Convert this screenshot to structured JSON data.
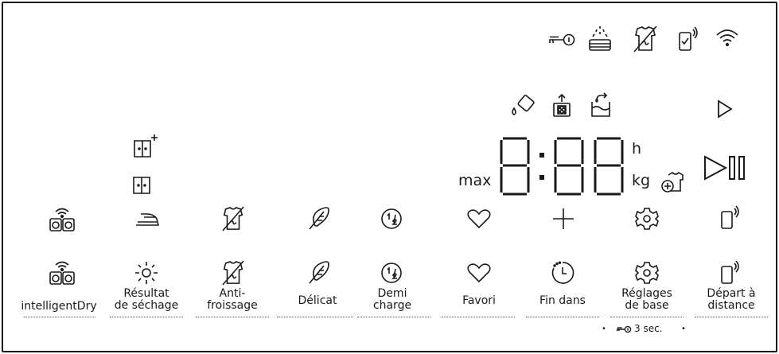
{
  "status_icons": [
    "key-lock-icon",
    "rinse-hold-icon",
    "no-crease-icon",
    "remote-ready-icon",
    "wifi-icon"
  ],
  "cycle_icons": [
    "drop-detergent-icon",
    "drum-clean-icon",
    "water-tank-icon",
    "play-icon"
  ],
  "program_icons": [
    "dry-level-plus-icon",
    "dry-level-icon"
  ],
  "display": {
    "time": "8:88",
    "unit_hours": "h",
    "unit_kg": "kg",
    "max_label": "max"
  },
  "buttons": [
    {
      "id": "intelligentdry",
      "label": "intelligentDry"
    },
    {
      "id": "drying-result",
      "label": "Résultat de séchage"
    },
    {
      "id": "anti-crease",
      "label": "Anti- froissage"
    },
    {
      "id": "delicate",
      "label": "Délicat"
    },
    {
      "id": "half-load",
      "label": "Demi charge"
    },
    {
      "id": "favorite",
      "label": "Favori"
    },
    {
      "id": "end-in",
      "label": "Fin dans"
    },
    {
      "id": "basic-settings",
      "label": "Réglages de base"
    },
    {
      "id": "remote-start",
      "label": "Départ à distance"
    }
  ],
  "labels": {
    "intelligentdry_l1": "intelligentDry",
    "drying_result_l1": "Résultat",
    "drying_result_l2": "de séchage",
    "anti_crease_l1": "Anti-",
    "anti_crease_l2": "froissage",
    "delicate_l1": "Délicat",
    "half_load_l1": "Demi",
    "half_load_l2": "charge",
    "favorite_l1": "Favori",
    "end_in_l1": "Fin dans",
    "settings_l1": "Réglages",
    "settings_l2": "de base",
    "remote_l1": "Départ à",
    "remote_l2": "distance"
  },
  "hint": {
    "text": "3 sec.",
    "bullet": "•"
  }
}
